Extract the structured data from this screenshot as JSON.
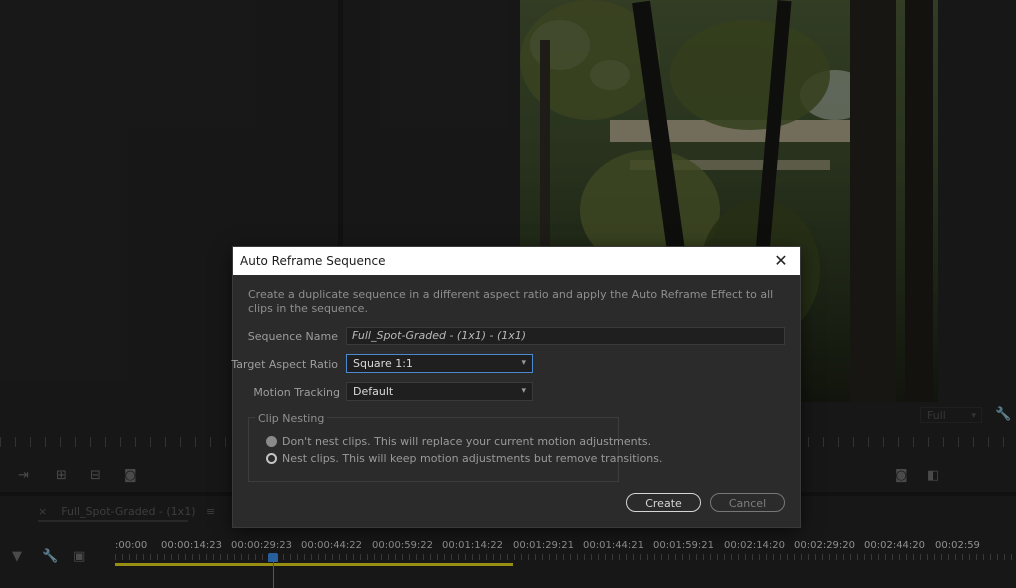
{
  "dialog": {
    "title": "Auto Reframe Sequence",
    "description": "Create a duplicate sequence in a different aspect ratio and apply the Auto Reframe Effect to all clips in the sequence.",
    "sequence_name_label": "Sequence Name",
    "sequence_name_value": "Full_Spot-Graded - (1x1) - (1x1)",
    "target_aspect_label": "Target Aspect Ratio",
    "target_aspect_value": "Square 1:1",
    "motion_tracking_label": "Motion Tracking",
    "motion_tracking_value": "Default",
    "clip_nesting_legend": "Clip Nesting",
    "option_dont_nest": "Don't nest clips. This will replace your current motion adjustments.",
    "option_nest": "Nest clips. This will keep motion adjustments but remove transitions.",
    "create_label": "Create",
    "cancel_label": "Cancel"
  },
  "monitor": {
    "zoom_value": "Full"
  },
  "timeline": {
    "sequence_tab": "Full_Spot-Graded - (1x1)",
    "close_glyph": "×",
    "menu_glyph": "≡",
    "timecodes": [
      ":00:00",
      "00:00:14:23",
      "00:00:29:23",
      "00:00:44:22",
      "00:00:59:22",
      "00:01:14:22",
      "00:01:29:21",
      "00:01:44:21",
      "00:01:59:21",
      "00:02:14:20",
      "00:02:29:20",
      "00:02:44:20",
      "00:02:59"
    ]
  },
  "icons": [
    "close-icon",
    "chevron-down-icon",
    "wrench-icon",
    "insert-icon",
    "lift-icon",
    "extract-icon",
    "camera-icon",
    "compare-icon",
    "marker-icon",
    "captions-icon",
    "snap-icon"
  ],
  "colors": {
    "playhead": "#3a8ee8",
    "work_area": "#e0d11b",
    "focus_border": "#4b8ad0"
  }
}
